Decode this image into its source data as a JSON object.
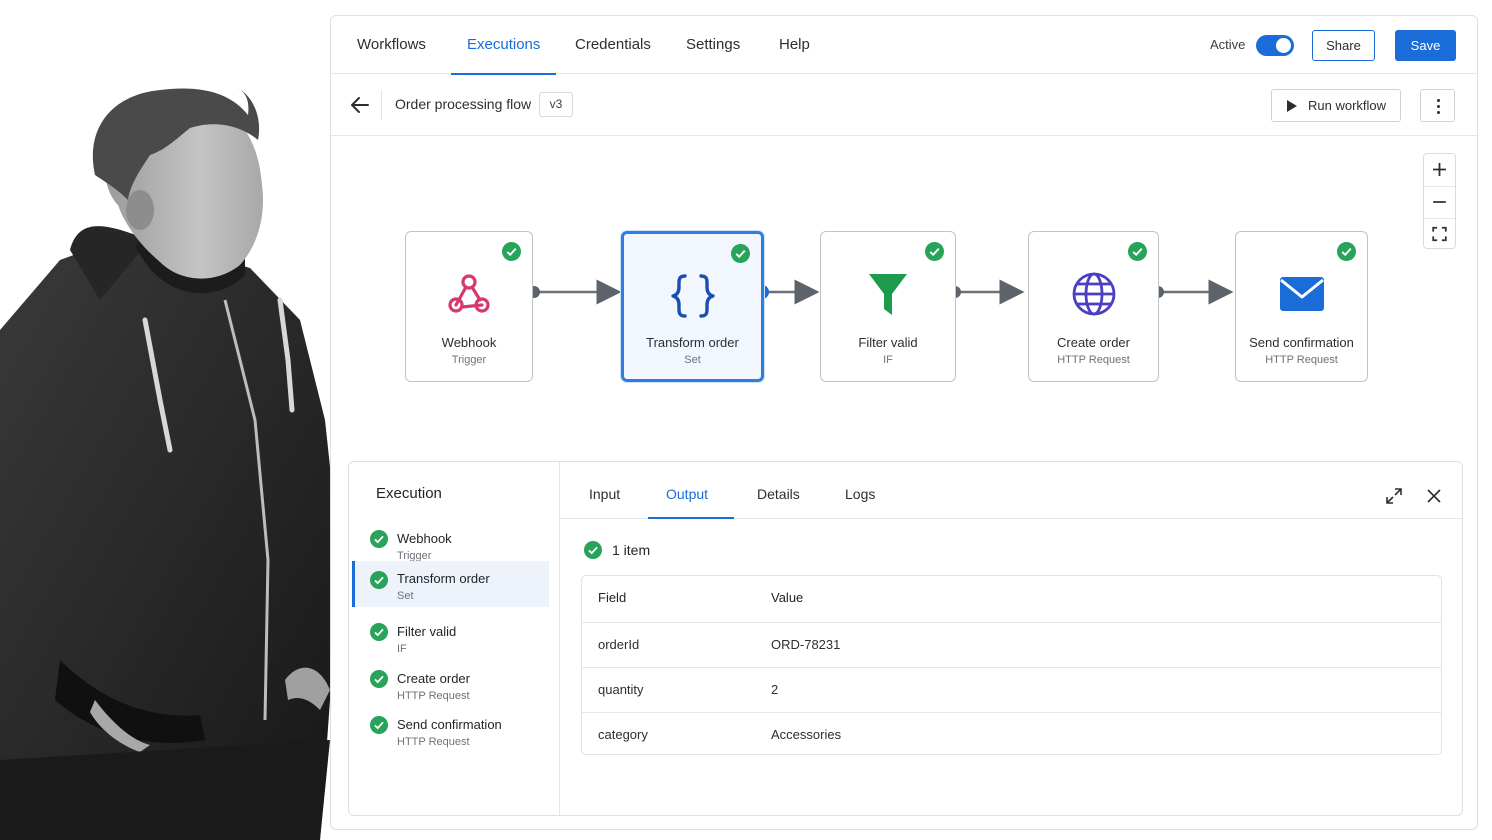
{
  "nav": {
    "tabs": [
      "Workflows",
      "Executions",
      "Credentials",
      "Settings",
      "Help"
    ],
    "active_label": "Active",
    "active_on": true,
    "share_label": "Share",
    "save_label": "Save"
  },
  "workflow": {
    "title": "Order processing flow",
    "version": "v3",
    "run_label": "Run workflow"
  },
  "nodes": [
    {
      "name": "Webhook",
      "type": "Trigger",
      "icon": "webhook-icon",
      "status": "success"
    },
    {
      "name": "Transform order",
      "type": "Set",
      "icon": "braces-icon",
      "status": "success",
      "selected": true
    },
    {
      "name": "Filter valid",
      "type": "IF",
      "icon": "filter-icon",
      "status": "success"
    },
    {
      "name": "Create order",
      "type": "HTTP Request",
      "icon": "globe-icon",
      "status": "success"
    },
    {
      "name": "Send confirmation",
      "type": "HTTP Request",
      "icon": "envelope-icon",
      "status": "success"
    }
  ],
  "execution": {
    "title": "Execution",
    "steps": [
      {
        "name": "Webhook",
        "type": "Trigger"
      },
      {
        "name": "Transform order",
        "type": "Set",
        "selected": true
      },
      {
        "name": "Filter valid",
        "type": "IF"
      },
      {
        "name": "Create order",
        "type": "HTTP Request"
      },
      {
        "name": "Send confirmation",
        "type": "HTTP Request"
      }
    ]
  },
  "panel": {
    "tabs": [
      "Input",
      "Output",
      "Details",
      "Logs"
    ],
    "active_tab": "Output",
    "items_label": "1 item",
    "table": {
      "headers": [
        "Field",
        "Value"
      ],
      "rows": [
        [
          "orderId",
          "ORD-78231"
        ],
        [
          "quantity",
          "2"
        ],
        [
          "category",
          "Accessories"
        ]
      ]
    }
  },
  "colors": {
    "accent": "#1a6dd9",
    "success": "#27a35a",
    "webhook": "#d63a6a",
    "filter": "#1e9a4c",
    "globe": "#4a3fc4",
    "envelope": "#1a6dd9"
  }
}
